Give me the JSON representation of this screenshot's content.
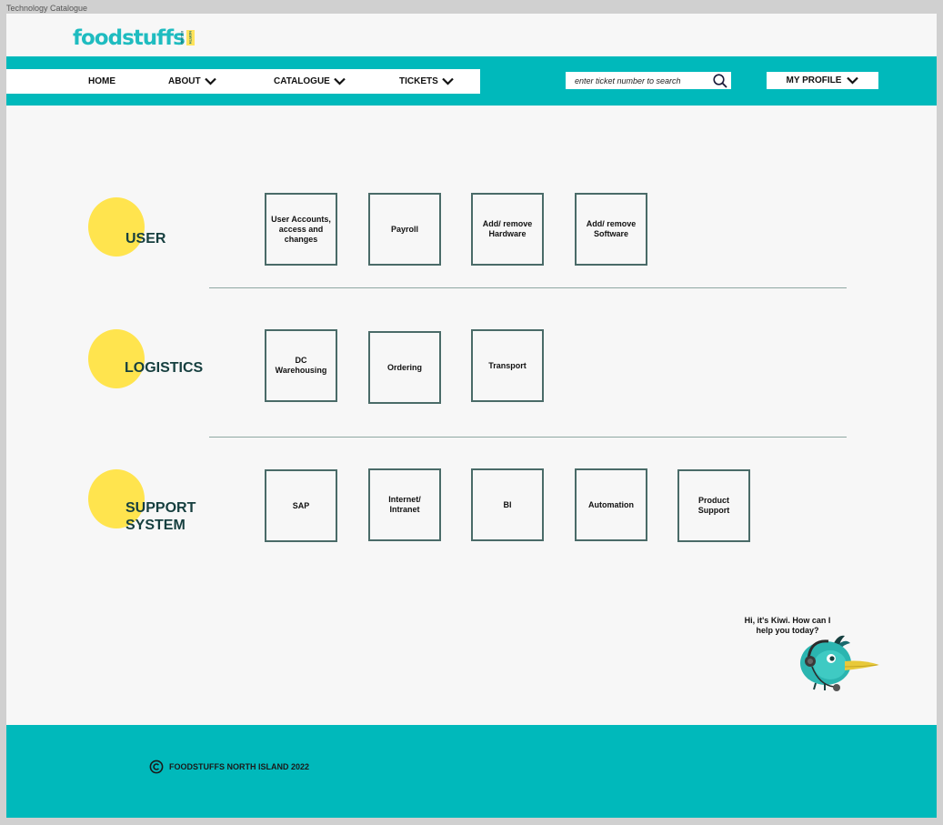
{
  "frame": {
    "label": "Technology Catalogue"
  },
  "brand": {
    "logo_text": "foodstuffs",
    "logo_tag": "NORTH ISLAND"
  },
  "nav": {
    "items": [
      {
        "label": "HOME"
      },
      {
        "label": "ABOUT"
      },
      {
        "label": "CATALOGUE"
      },
      {
        "label": "TICKETS"
      }
    ],
    "search": {
      "placeholder": "enter ticket number to search"
    },
    "profile_label": "MY PROFILE"
  },
  "sections": [
    {
      "title": "USER",
      "tiles": [
        "User Accounts, access and changes",
        "Payroll",
        "Add/ remove Hardware",
        "Add/ remove Software"
      ]
    },
    {
      "title": "LOGISTICS",
      "tiles": [
        "DC Warehousing",
        "Ordering",
        "Transport"
      ]
    },
    {
      "title": "SUPPORT SYSTEM",
      "tiles": [
        "SAP",
        "Internet/ Intranet",
        "BI",
        "Automation",
        "Product Support"
      ]
    }
  ],
  "assistant": {
    "message": "Hi, it's Kiwi. How can I help you today?"
  },
  "footer": {
    "copyright": "FOODSTUFFS NORTH ISLAND 2022"
  },
  "colors": {
    "teal": "#00b9bb",
    "yellow": "#ffe44e",
    "heading": "#163f3f",
    "tile_border": "#4a6b68"
  }
}
